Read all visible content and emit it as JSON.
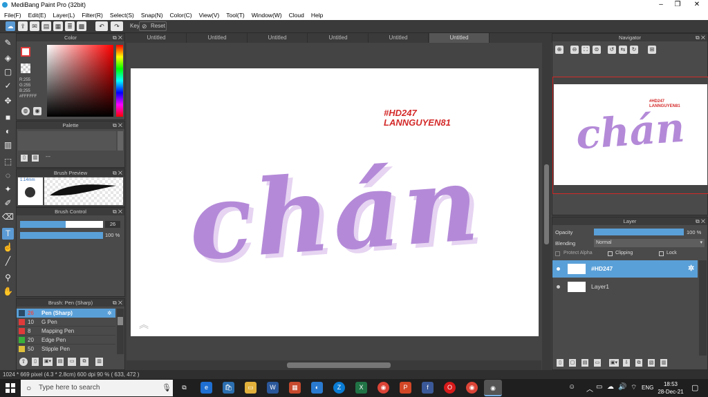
{
  "window": {
    "title": "MediBang Paint Pro (32bit)",
    "minimize": "–",
    "maximize": "❐",
    "close": "✕"
  },
  "menu": [
    "File(F)",
    "Edit(E)",
    "Layer(L)",
    "Filter(R)",
    "Select(S)",
    "Snap(N)",
    "Color(C)",
    "View(V)",
    "Tool(T)",
    "Window(W)",
    "Cloud",
    "Help"
  ],
  "toolbar": {
    "key_label": "Key",
    "reset_label": "Reset"
  },
  "tabs": [
    "Untitled",
    "Untitled",
    "Untitled",
    "Untitled",
    "Untitled",
    "Untitled"
  ],
  "color_panel": {
    "title": "Color",
    "r": "R:255",
    "g": "G:255",
    "b": "B:255",
    "hex": "#FFFFFF"
  },
  "palette_panel": {
    "title": "Palette",
    "dash": "---"
  },
  "brush_preview": {
    "title": "Brush Preview",
    "size": "1.14mm"
  },
  "brush_control": {
    "title": "Brush Control",
    "size_value": "26",
    "opacity_value": "100 %",
    "size_level": 0.55,
    "opacity_level": 1.0
  },
  "brush_list": {
    "title": "Brush: Pen (Sharp)",
    "items": [
      {
        "num": "26",
        "name": "Pen (Sharp)",
        "color": "#2a4a66",
        "active": true
      },
      {
        "num": "10",
        "name": "G Pen",
        "color": "#e03a3a",
        "active": false
      },
      {
        "num": "8",
        "name": "Mapping Pen",
        "color": "#e03a3a",
        "active": false
      },
      {
        "num": "20",
        "name": "Edge Pen",
        "color": "#3ab03a",
        "active": false
      },
      {
        "num": "50",
        "name": "Stipple Pen",
        "color": "#e0c03a",
        "active": false
      }
    ]
  },
  "canvas": {
    "tag1": "#HD247",
    "tag2": "LANNGUYEN81",
    "word": "chán",
    "accent": "#b48ad8"
  },
  "navigator": {
    "title": "Navigator"
  },
  "layer_panel": {
    "title": "Layer",
    "opacity_label": "Opacity",
    "opacity_value": "100 %",
    "opacity_level": 1.0,
    "blending_label": "Blending",
    "blending_value": "Normal",
    "protect_alpha": "Protect Alpha",
    "clipping": "Clipping",
    "lock": "Lock",
    "layers": [
      {
        "name": "#HD247",
        "active": true
      },
      {
        "name": "Layer1",
        "active": false
      }
    ]
  },
  "status": {
    "text": "1024 * 669 pixel  (4.3 * 2.8cm)  600 dpi  90 %  ( 633, 472 )"
  },
  "taskbar": {
    "search_placeholder": "Type here to search",
    "lang": "ENG",
    "time": "18:53",
    "date": "28-Dec-21"
  }
}
